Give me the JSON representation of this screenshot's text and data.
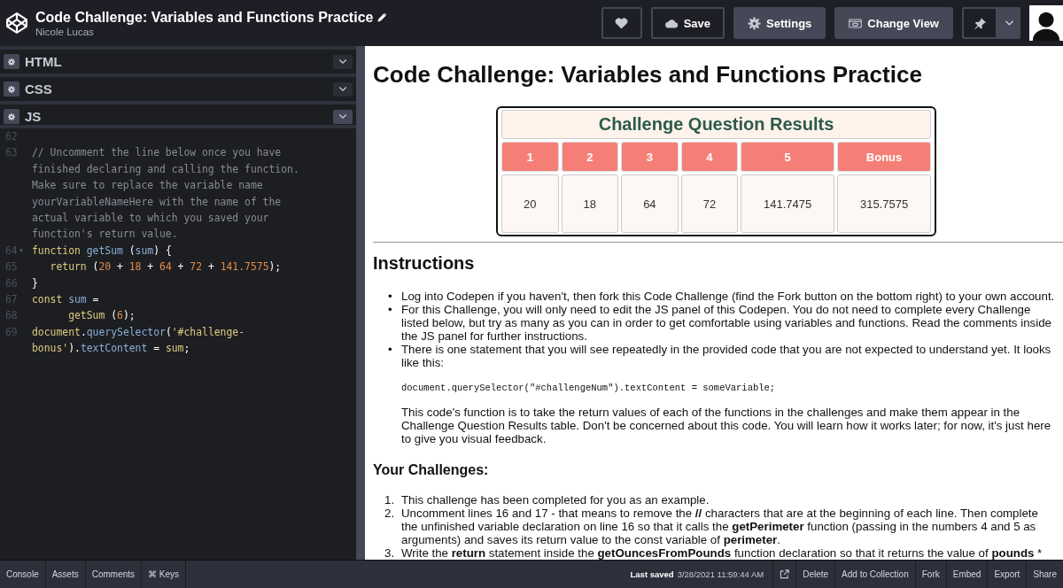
{
  "header": {
    "title": "Code Challenge: Variables and Functions Practice",
    "author": "Nicole Lucas"
  },
  "toolbar": [
    {
      "kind": "heart"
    },
    {
      "kind": "save",
      "label": "Save"
    },
    {
      "kind": "settings",
      "label": "Settings"
    },
    {
      "kind": "view",
      "label": "Change View"
    },
    {
      "kind": "pin"
    },
    {
      "kind": "avatar"
    }
  ],
  "editor_panels": [
    {
      "label": "HTML",
      "selected": false
    },
    {
      "label": "CSS",
      "selected": false
    },
    {
      "label": "JS",
      "selected": true
    }
  ],
  "code_lines": [
    {
      "number": "62"
    },
    {
      "number": "63",
      "tokens": [
        {
          "kind": "comment",
          "text": "// Uncomment the line below once you have"
        }
      ]
    },
    {
      "tokens": [
        {
          "kind": "comment",
          "text": "finished declaring and calling the function."
        }
      ]
    },
    {
      "tokens": [
        {
          "kind": "comment",
          "text": "Make sure to replace the variable name"
        }
      ]
    },
    {
      "tokens": [
        {
          "kind": "comment",
          "text": "yourVariableNameHere with the name of the"
        }
      ]
    },
    {
      "tokens": [
        {
          "kind": "comment",
          "text": "actual variable to which you saved your"
        }
      ]
    },
    {
      "tokens": [
        {
          "kind": "comment",
          "text": "function's return value."
        }
      ]
    },
    {
      "number": "64",
      "fold": true,
      "tokens": [
        {
          "kind": "keyword",
          "text": "function"
        },
        {
          "kind": "name",
          "text": " getSum"
        },
        {
          "kind": "plain",
          "text": " ("
        },
        {
          "kind": "name",
          "text": "sum"
        },
        {
          "kind": "plain",
          "text": ") {"
        }
      ]
    },
    {
      "number": "65",
      "tokens": [
        {
          "kind": "keyword",
          "text": "   return"
        },
        {
          "kind": "plain",
          "text": " ("
        },
        {
          "kind": "number",
          "text": "20"
        },
        {
          "kind": "plain",
          "text": " + "
        },
        {
          "kind": "number",
          "text": "18"
        },
        {
          "kind": "plain",
          "text": " + "
        },
        {
          "kind": "number",
          "text": "64"
        },
        {
          "kind": "plain",
          "text": " + "
        },
        {
          "kind": "number",
          "text": "72"
        },
        {
          "kind": "plain",
          "text": " + "
        },
        {
          "kind": "number",
          "text": "141.7575"
        },
        {
          "kind": "plain",
          "text": ");"
        }
      ]
    },
    {
      "number": "66",
      "tokens": [
        {
          "kind": "plain",
          "text": "}"
        }
      ]
    },
    {
      "number": "67",
      "tokens": [
        {
          "kind": "keyword",
          "text": "const"
        },
        {
          "kind": "name",
          "text": " sum"
        },
        {
          "kind": "plain",
          "text": " ="
        }
      ]
    },
    {
      "number": "68",
      "tokens": [
        {
          "kind": "keyword",
          "text": "      getSum"
        },
        {
          "kind": "plain",
          "text": " ("
        },
        {
          "kind": "number",
          "text": "6"
        },
        {
          "kind": "plain",
          "text": ");"
        }
      ]
    },
    {
      "number": "69",
      "tokens": [
        {
          "kind": "keyword",
          "text": "document"
        },
        {
          "kind": "plain",
          "text": "."
        },
        {
          "kind": "name",
          "text": "querySelector"
        },
        {
          "kind": "plain",
          "text": "("
        },
        {
          "kind": "string",
          "text": "'#challenge-"
        }
      ]
    },
    {
      "tokens": [
        {
          "kind": "string",
          "text": "bonus'"
        },
        {
          "kind": "plain",
          "text": ")."
        },
        {
          "kind": "name",
          "text": "textContent"
        },
        {
          "kind": "plain",
          "text": " = "
        },
        {
          "kind": "keyword",
          "text": "sum"
        },
        {
          "kind": "plain",
          "text": ";"
        }
      ]
    }
  ],
  "preview": {
    "title": "Code Challenge: Variables and Functions Practice",
    "results": {
      "caption": "Challenge Question Results",
      "columns": [
        "1",
        "2",
        "3",
        "4",
        "5",
        "Bonus"
      ],
      "values": [
        "20",
        "18",
        "64",
        "72",
        "141.7475",
        "315.7575"
      ]
    },
    "instructions_heading": "Instructions",
    "instructions": [
      {
        "marker": "•",
        "text": "Log into Codepen if you haven't, then fork this Code Challenge (find the Fork button on the bottom right) to your own account."
      },
      {
        "marker": "•",
        "text": "For this Challenge, you will only need to edit the JS panel of this Codepen. You do not need to complete every Challenge listed below, but try as many as you can in order to get comfortable using variables and functions. Read the comments inside the JS panel for further instructions."
      },
      {
        "marker": "•",
        "text": "There is one statement that you will see repeatedly in the provided code that you are not expected to understand yet. It looks like this:",
        "code": "document.querySelector(\"#challengeNum\").textContent = someVariable;",
        "note": "This code's function is to take the return values of each of the functions in the challenges and make them appear in the Challenge Question Results table. Don't be concerned about this code. You will learn how it works later; for now, it's just here to give you visual feedback."
      }
    ],
    "challenges_heading": "Your Challenges:",
    "challenges": [
      {
        "marker": "1.",
        "text": "This challenge has been completed for you as an example."
      },
      {
        "marker": "2.",
        "text": "Uncomment lines 16 and 17 - that means to remove the **//** characters that are at the beginning of each line. Then complete the unfinished variable declaration on line 16 so that it calls the **getPerimeter** function (passing in the numbers 4 and 5 as arguments) and saves its return value to the const variable of **perimeter**."
      },
      {
        "marker": "3.",
        "text": "Write the **return** statement inside the **getOuncesFromPounds** function declaration so that it returns the value of **pounds** *"
      }
    ]
  },
  "footer": {
    "left": [
      "Console",
      "Assets",
      "Comments",
      "⌘ Keys"
    ],
    "saved_label": "Last saved",
    "saved_time": "3/28/2021 11:59:44 AM",
    "right": [
      "Delete",
      "Add to Collection",
      "Fork",
      "Embed",
      "Export",
      "Share"
    ]
  }
}
